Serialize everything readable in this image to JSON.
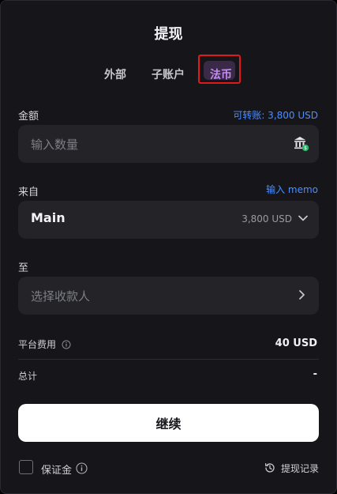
{
  "dialog": {
    "title": "提现"
  },
  "tabs": [
    {
      "label": "外部"
    },
    {
      "label": "子账户"
    },
    {
      "label": "法币",
      "active": true
    }
  ],
  "amount": {
    "label": "金额",
    "available": "可转账: 3,800 USD",
    "placeholder": "输入数量",
    "icon": "bank-icon"
  },
  "from": {
    "label": "来自",
    "memo_link": "输入 memo",
    "account": "Main",
    "balance": "3,800 USD",
    "icon": "chevron-down-icon"
  },
  "to": {
    "label": "至",
    "placeholder": "选择收款人",
    "icon": "chevron-right-icon"
  },
  "summary": {
    "fee_label": "平台费用",
    "fee_value": "40 USD",
    "total_label": "总计",
    "total_value": "-"
  },
  "continue_label": "继续",
  "footer": {
    "margin_label": "保证金",
    "history_label": "提现记录"
  },
  "colors": {
    "background": "#16161a",
    "field": "#232328",
    "accent_link": "#4c8dff",
    "active_tab": "#c58cf5",
    "highlight": "#e0191a"
  }
}
